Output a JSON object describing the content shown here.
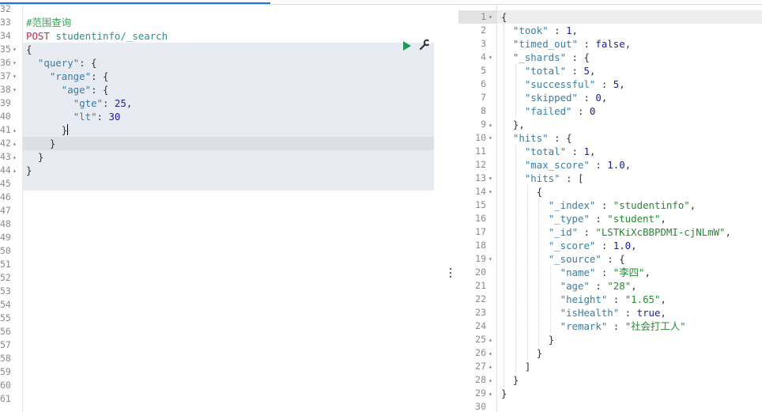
{
  "editor": {
    "run_icon": "play-icon",
    "settings_icon": "wrench-icon",
    "lines": [
      {
        "n": "32",
        "fold": "",
        "html": ""
      },
      {
        "n": "33",
        "fold": "",
        "html": "<span class=\"cmt\">#范围查询</span>"
      },
      {
        "n": "34",
        "fold": "",
        "html": "<span class=\"kw\">POST</span> <span class=\"url\">studentinfo/_search</span>"
      },
      {
        "n": "35",
        "fold": "▾",
        "html": "<span class=\"p\">{</span>"
      },
      {
        "n": "36",
        "fold": "▾",
        "html": "  <span class=\"k\">\"query\"</span><span class=\"p\">: {</span>"
      },
      {
        "n": "37",
        "fold": "▾",
        "html": "    <span class=\"k\">\"range\"</span><span class=\"p\">: {</span>"
      },
      {
        "n": "38",
        "fold": "▾",
        "html": "      <span class=\"k\">\"age\"</span><span class=\"p\">: {</span>"
      },
      {
        "n": "39",
        "fold": "",
        "html": "        <span class=\"k\">\"gte\"</span><span class=\"p\">: </span><span class=\"n\">25</span><span class=\"p\">,</span>"
      },
      {
        "n": "40",
        "fold": "",
        "html": "        <span class=\"k\">\"lt\"</span><span class=\"p\">: </span><span class=\"n\">30</span>"
      },
      {
        "n": "41",
        "fold": "▴",
        "html": "      <span class=\"p\">}</span><span class=\"cursor\"></span>"
      },
      {
        "n": "42",
        "fold": "▴",
        "html": "    <span class=\"p\">}</span>"
      },
      {
        "n": "43",
        "fold": "▴",
        "html": "  <span class=\"p\">}</span>"
      },
      {
        "n": "44",
        "fold": "▴",
        "html": "<span class=\"p\">}</span>"
      },
      {
        "n": "45",
        "fold": "",
        "html": ""
      },
      {
        "n": "46",
        "fold": "",
        "html": ""
      },
      {
        "n": "47",
        "fold": "",
        "html": ""
      },
      {
        "n": "48",
        "fold": "",
        "html": ""
      },
      {
        "n": "49",
        "fold": "",
        "html": ""
      },
      {
        "n": "50",
        "fold": "",
        "html": ""
      },
      {
        "n": "51",
        "fold": "",
        "html": ""
      },
      {
        "n": "52",
        "fold": "",
        "html": ""
      },
      {
        "n": "53",
        "fold": "",
        "html": ""
      },
      {
        "n": "54",
        "fold": "",
        "html": ""
      },
      {
        "n": "55",
        "fold": "",
        "html": ""
      },
      {
        "n": "56",
        "fold": "",
        "html": ""
      },
      {
        "n": "57",
        "fold": "",
        "html": ""
      },
      {
        "n": "58",
        "fold": "",
        "html": ""
      },
      {
        "n": "59",
        "fold": "",
        "html": ""
      },
      {
        "n": "60",
        "fold": "",
        "html": ""
      },
      {
        "n": "61",
        "fold": "",
        "html": ""
      }
    ]
  },
  "response": {
    "lines": [
      {
        "n": "1",
        "fold": "▾",
        "html": "<span class=\"p\">{</span>"
      },
      {
        "n": "2",
        "fold": "",
        "html": "  <span class=\"k\">\"took\"</span><span class=\"p\"> : </span><span class=\"n\">1</span><span class=\"p\">,</span>"
      },
      {
        "n": "3",
        "fold": "",
        "html": "  <span class=\"k\">\"timed_out\"</span><span class=\"p\"> : </span><span class=\"b\">false</span><span class=\"p\">,</span>"
      },
      {
        "n": "4",
        "fold": "▾",
        "html": "  <span class=\"k\">\"_shards\"</span><span class=\"p\"> : {</span>"
      },
      {
        "n": "5",
        "fold": "",
        "html": "    <span class=\"k\">\"total\"</span><span class=\"p\"> : </span><span class=\"n\">5</span><span class=\"p\">,</span>"
      },
      {
        "n": "6",
        "fold": "",
        "html": "    <span class=\"k\">\"successful\"</span><span class=\"p\"> : </span><span class=\"n\">5</span><span class=\"p\">,</span>"
      },
      {
        "n": "7",
        "fold": "",
        "html": "    <span class=\"k\">\"skipped\"</span><span class=\"p\"> : </span><span class=\"n\">0</span><span class=\"p\">,</span>"
      },
      {
        "n": "8",
        "fold": "",
        "html": "    <span class=\"k\">\"failed\"</span><span class=\"p\"> : </span><span class=\"n\">0</span>"
      },
      {
        "n": "9",
        "fold": "▴",
        "html": "  <span class=\"p\">},</span>"
      },
      {
        "n": "10",
        "fold": "▾",
        "html": "  <span class=\"k\">\"hits\"</span><span class=\"p\"> : {</span>"
      },
      {
        "n": "11",
        "fold": "",
        "html": "    <span class=\"k\">\"total\"</span><span class=\"p\"> : </span><span class=\"n\">1</span><span class=\"p\">,</span>"
      },
      {
        "n": "12",
        "fold": "",
        "html": "    <span class=\"k\">\"max_score\"</span><span class=\"p\"> : </span><span class=\"n\">1.0</span><span class=\"p\">,</span>"
      },
      {
        "n": "13",
        "fold": "▾",
        "html": "    <span class=\"k\">\"hits\"</span><span class=\"p\"> : [</span>"
      },
      {
        "n": "14",
        "fold": "▾",
        "html": "      <span class=\"p\">{</span>"
      },
      {
        "n": "15",
        "fold": "",
        "html": "        <span class=\"k\">\"_index\"</span><span class=\"p\"> : </span><span class=\"s\">\"studentinfo\"</span><span class=\"p\">,</span>"
      },
      {
        "n": "16",
        "fold": "",
        "html": "        <span class=\"k\">\"_type\"</span><span class=\"p\"> : </span><span class=\"s\">\"student\"</span><span class=\"p\">,</span>"
      },
      {
        "n": "17",
        "fold": "",
        "html": "        <span class=\"k\">\"_id\"</span><span class=\"p\"> : </span><span class=\"s\">\"LSTKiXcBBPDMI-cjNLmW\"</span><span class=\"p\">,</span>"
      },
      {
        "n": "18",
        "fold": "",
        "html": "        <span class=\"k\">\"_score\"</span><span class=\"p\"> : </span><span class=\"n\">1.0</span><span class=\"p\">,</span>"
      },
      {
        "n": "19",
        "fold": "▾",
        "html": "        <span class=\"k\">\"_source\"</span><span class=\"p\"> : {</span>"
      },
      {
        "n": "20",
        "fold": "",
        "html": "          <span class=\"k\">\"name\"</span><span class=\"p\"> : </span><span class=\"s\">\"李四\"</span><span class=\"p\">,</span>"
      },
      {
        "n": "21",
        "fold": "",
        "html": "          <span class=\"k\">\"age\"</span><span class=\"p\"> : </span><span class=\"s\">\"28\"</span><span class=\"p\">,</span>"
      },
      {
        "n": "22",
        "fold": "",
        "html": "          <span class=\"k\">\"height\"</span><span class=\"p\"> : </span><span class=\"s\">\"1.65\"</span><span class=\"p\">,</span>"
      },
      {
        "n": "23",
        "fold": "",
        "html": "          <span class=\"k\">\"isHealth\"</span><span class=\"p\"> : </span><span class=\"b\">true</span><span class=\"p\">,</span>"
      },
      {
        "n": "24",
        "fold": "",
        "html": "          <span class=\"k\">\"remark\"</span><span class=\"p\"> : </span><span class=\"s\">\"社会打工人\"</span>"
      },
      {
        "n": "25",
        "fold": "▴",
        "html": "        <span class=\"p\">}</span>"
      },
      {
        "n": "26",
        "fold": "▴",
        "html": "      <span class=\"p\">}</span>"
      },
      {
        "n": "27",
        "fold": "▴",
        "html": "    <span class=\"p\">]</span>"
      },
      {
        "n": "28",
        "fold": "▴",
        "html": "  <span class=\"p\">}</span>"
      },
      {
        "n": "29",
        "fold": "▴",
        "html": "<span class=\"p\">}</span>"
      },
      {
        "n": "30",
        "fold": "",
        "html": ""
      }
    ]
  }
}
